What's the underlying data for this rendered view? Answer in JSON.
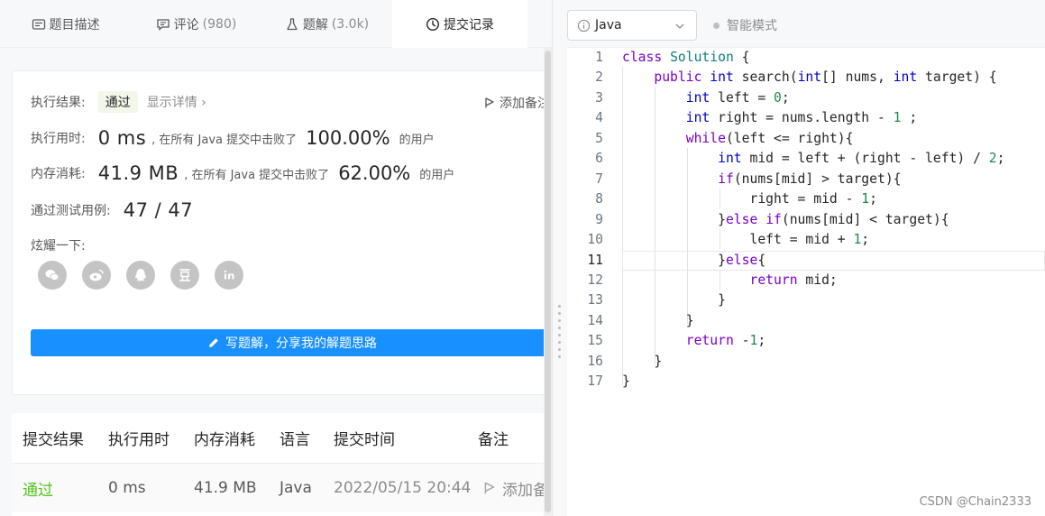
{
  "tabs": [
    {
      "label": "题目描述",
      "icon": "description-icon"
    },
    {
      "label": "评论",
      "count": "(980)",
      "icon": "comment-icon"
    },
    {
      "label": "题解",
      "count": "(3.0k)",
      "icon": "flask-icon"
    },
    {
      "label": "提交记录",
      "icon": "clock-icon"
    }
  ],
  "result": {
    "label": "执行结果:",
    "status": "通过",
    "details": "显示详情 ›",
    "add_note": "添加备注"
  },
  "runtime": {
    "label": "执行用时:",
    "value": "0 ms",
    "middle": ", 在所有 Java 提交中击败了",
    "percent": "100.00%",
    "suffix": "的用户"
  },
  "memory": {
    "label": "内存消耗:",
    "value": "41.9 MB",
    "middle": ", 在所有 Java 提交中击败了",
    "percent": "62.00%",
    "suffix": "的用户"
  },
  "tests": {
    "label": "通过测试用例:",
    "value": "47 / 47"
  },
  "share": {
    "label": "炫耀一下:",
    "icons": [
      "wechat-icon",
      "weibo-icon",
      "qq-icon",
      "douban-icon",
      "linkedin-icon"
    ]
  },
  "write_solution": "写题解，分享我的解题思路",
  "table": {
    "headers": [
      "提交结果",
      "执行用时",
      "内存消耗",
      "语言",
      "提交时间",
      "备注"
    ],
    "row": {
      "result": "通过",
      "time": "0 ms",
      "memory": "41.9 MB",
      "lang": "Java",
      "submitted": "2022/05/15 20:44",
      "note": "添加备"
    }
  },
  "editor": {
    "language": "Java",
    "smart_mode": "智能模式",
    "current_line": 11,
    "code_lines": [
      "class Solution {",
      "    public int search(int[] nums, int target) {",
      "        int left = 0;",
      "        int right = nums.length - 1 ;",
      "        while(left <= right){",
      "            int mid = left + (right - left) / 2;",
      "            if(nums[mid] > target){",
      "                right = mid - 1;",
      "            }else if(nums[mid] < target){",
      "                left = mid + 1;",
      "            }else{",
      "                return mid;",
      "            }",
      "        }",
      "        return -1;",
      "    }",
      "}"
    ]
  },
  "watermark": "CSDN @Chain2333",
  "colors": {
    "accent": "#1890ff",
    "success": "#52c41a",
    "keyword": "#7a00cc",
    "type": "#0f7d80",
    "number": "#1f8a4c"
  }
}
